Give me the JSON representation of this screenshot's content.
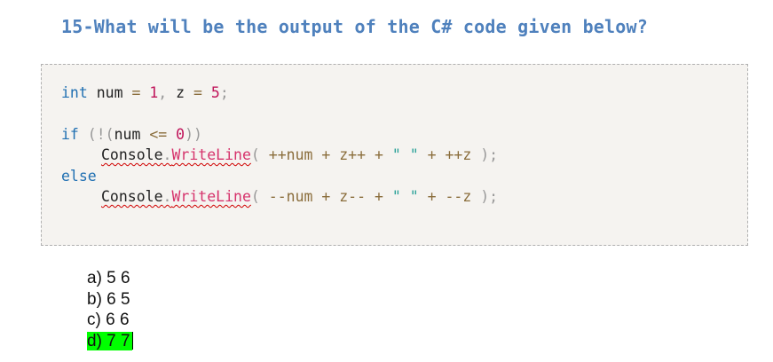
{
  "question": {
    "text": "15-What will be the output of the C# code given below?"
  },
  "code": {
    "line1": {
      "kw": "int",
      "rest_a": " num ",
      "eq1": "=",
      "n1": " 1",
      "comma": ",",
      "rest_b": " z ",
      "eq2": "=",
      "n2": " 5",
      "semi": ";"
    },
    "line2": {
      "kw": "if",
      "p1": " (!(",
      "var": "num ",
      "op": "<=",
      "n": " 0",
      "p2": "))"
    },
    "line3": {
      "obj": "Console",
      "dot": ".",
      "method": "WriteLine",
      "p1": "( ",
      "expr1": "++num + z++ + ",
      "str": "\" \"",
      "expr2": " + ++z ",
      "p2": ");"
    },
    "line4": {
      "kw": "else"
    },
    "line5": {
      "obj": "Console",
      "dot": ".",
      "method": "WriteLine",
      "p1": "( ",
      "expr1": "--num + z-- + ",
      "str": "\" \"",
      "expr2": " + --z ",
      "p2": ");"
    }
  },
  "options": [
    {
      "label": "a) 5 6",
      "selected": false
    },
    {
      "label": "b) 6 5",
      "selected": false
    },
    {
      "label": "c) 6 6",
      "selected": false
    },
    {
      "label": "d) 7 7",
      "selected": true
    }
  ],
  "colors": {
    "question": "#4f81bd",
    "keyword": "#1f6fb2",
    "number": "#c0145a",
    "method": "#d6336c",
    "highlight": "#00ff00",
    "code_background": "#f5f3f0"
  }
}
